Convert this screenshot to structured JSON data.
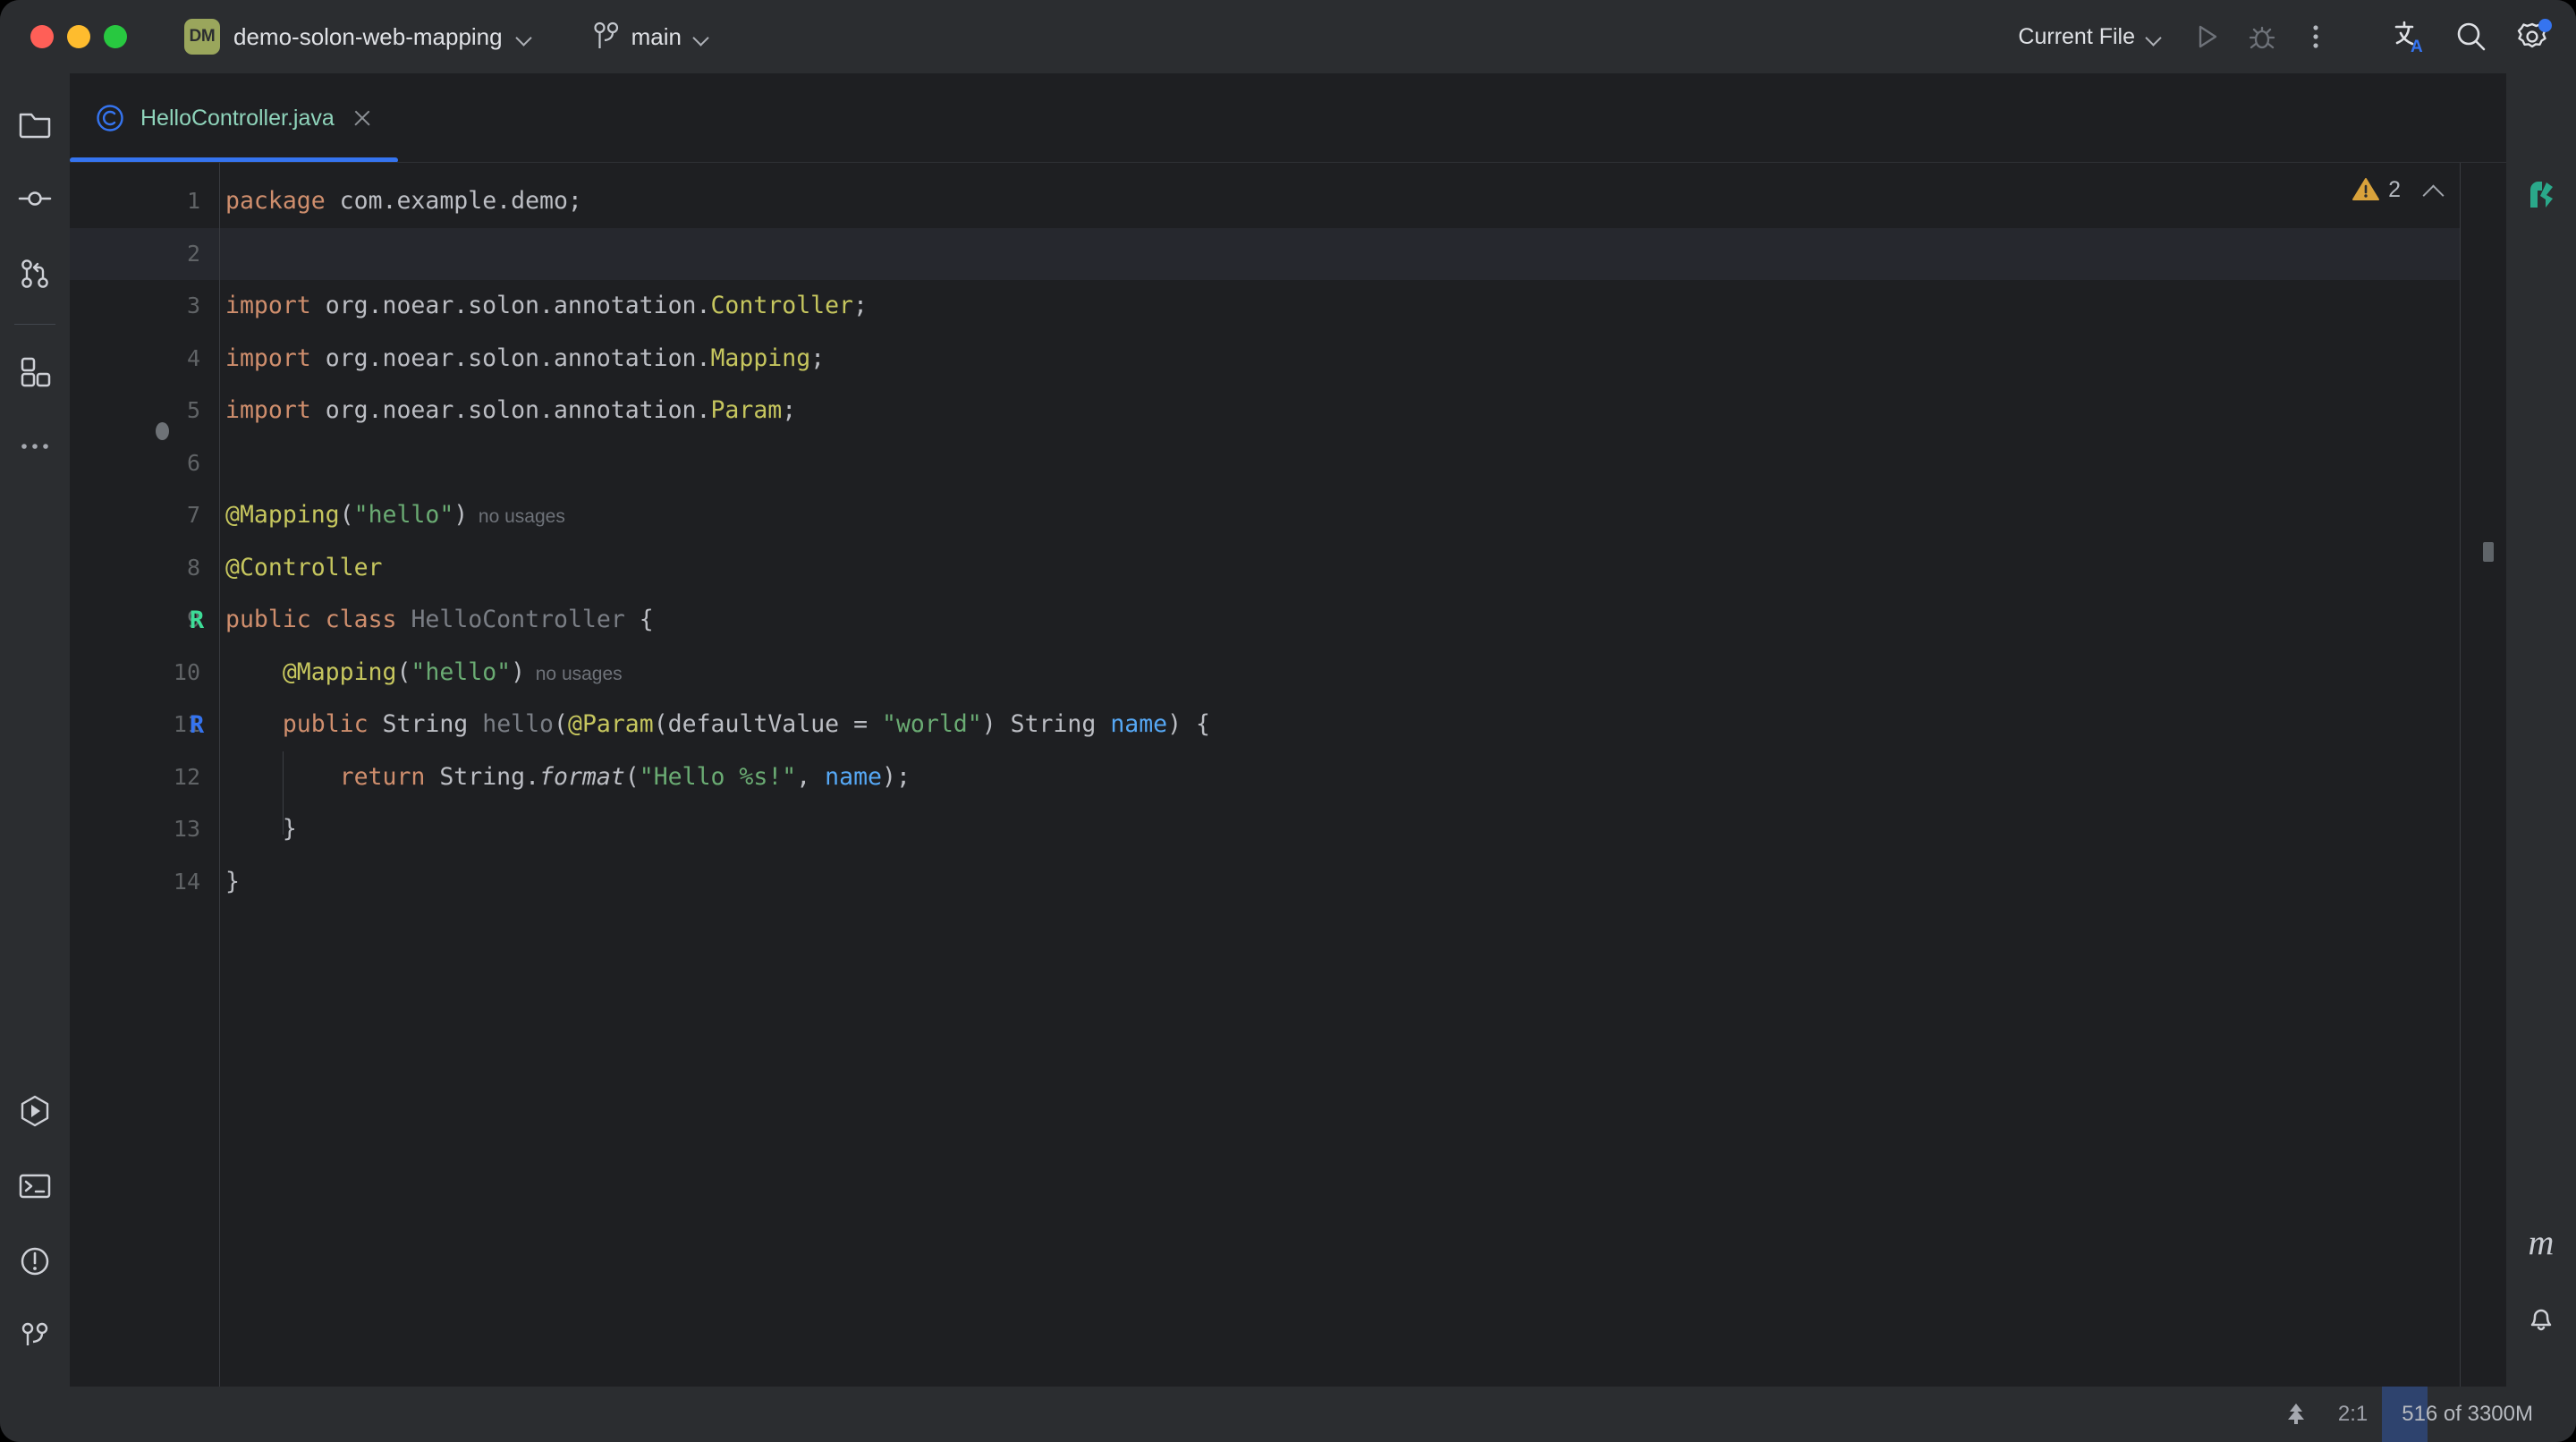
{
  "window": {
    "traffic_lights": [
      "close",
      "minimize",
      "maximize"
    ],
    "bg": "#2b2d30"
  },
  "titlebar": {
    "project_badge": "DM",
    "project_name": "demo-solon-web-mapping",
    "branch_name": "main",
    "run_config": "Current File",
    "icons": [
      "run-icon",
      "debug-icon",
      "more-options-icon",
      "translate-icon",
      "search-everywhere-icon",
      "settings-icon"
    ]
  },
  "sidebar_left": {
    "items": [
      {
        "name": "project-tool-window",
        "icon": "folder-icon"
      },
      {
        "name": "commit-tool-window",
        "icon": "commit-icon"
      },
      {
        "name": "pull-requests-tool-window",
        "icon": "pull-request-icon"
      },
      {
        "name": "plugins-tool-window",
        "icon": "grid-blocks-icon"
      },
      {
        "name": "more-tool-windows",
        "icon": "ellipsis-icon"
      }
    ],
    "bottom_items": [
      {
        "name": "run-tool-window",
        "icon": "run-hexagon-icon"
      },
      {
        "name": "terminal-tool-window",
        "icon": "terminal-icon"
      },
      {
        "name": "problems-tool-window",
        "icon": "problems-icon"
      },
      {
        "name": "version-control-tool-window",
        "icon": "branch-icon"
      }
    ]
  },
  "sidebar_right": {
    "top_items": [
      {
        "name": "solon-plugin-tool-window",
        "icon": "solon-leaf-icon"
      }
    ],
    "bottom_items": [
      {
        "name": "maven-tool-window",
        "icon": "maven-m-icon",
        "label": "m"
      },
      {
        "name": "notifications-tool-window",
        "icon": "bell-icon"
      }
    ]
  },
  "tabs": [
    {
      "label": "HelloController.java",
      "icon": "java-class-icon",
      "active": true,
      "closable": true
    }
  ],
  "editor": {
    "inspection": {
      "warning_count": "2",
      "icon": "warning-triangle-icon"
    },
    "current_line": 2,
    "lines": [
      {
        "n": 1,
        "indent": 0,
        "tokens": [
          {
            "t": "package",
            "c": "kw"
          },
          {
            "t": " ",
            "c": "pln"
          },
          {
            "t": "com.example.demo;",
            "c": "pln"
          }
        ]
      },
      {
        "n": 2,
        "indent": 0,
        "tokens": []
      },
      {
        "n": 3,
        "indent": 0,
        "tokens": [
          {
            "t": "import",
            "c": "kw"
          },
          {
            "t": " org.noear.solon.annotation.",
            "c": "pln"
          },
          {
            "t": "Controller",
            "c": "cls"
          },
          {
            "t": ";",
            "c": "pln"
          }
        ]
      },
      {
        "n": 4,
        "indent": 0,
        "tokens": [
          {
            "t": "import",
            "c": "kw"
          },
          {
            "t": " org.noear.solon.annotation.",
            "c": "pln"
          },
          {
            "t": "Mapping",
            "c": "cls"
          },
          {
            "t": ";",
            "c": "pln"
          }
        ]
      },
      {
        "n": 5,
        "indent": 0,
        "tokens": [
          {
            "t": "import",
            "c": "kw"
          },
          {
            "t": " org.noear.solon.annotation.",
            "c": "pln"
          },
          {
            "t": "Param",
            "c": "cls"
          },
          {
            "t": ";",
            "c": "pln"
          }
        ]
      },
      {
        "n": 6,
        "indent": 0,
        "tokens": []
      },
      {
        "n": 7,
        "indent": 0,
        "tokens": [
          {
            "t": "@Mapping",
            "c": "ann"
          },
          {
            "t": "(",
            "c": "pln"
          },
          {
            "t": "\"hello\"",
            "c": "str"
          },
          {
            "t": ")",
            "c": "pln"
          },
          {
            "t": "  no usages",
            "c": "hint"
          }
        ]
      },
      {
        "n": 8,
        "indent": 0,
        "tokens": [
          {
            "t": "@Controller",
            "c": "ann"
          }
        ]
      },
      {
        "n": 9,
        "indent": 0,
        "gutter": "R",
        "gutter_color": "green",
        "tokens": [
          {
            "t": "public",
            "c": "kw"
          },
          {
            "t": " ",
            "c": "pln"
          },
          {
            "t": "class",
            "c": "kw"
          },
          {
            "t": " ",
            "c": "pln"
          },
          {
            "t": "HelloController",
            "c": "mth"
          },
          {
            "t": " {",
            "c": "pln"
          }
        ]
      },
      {
        "n": 10,
        "indent": 1,
        "tokens": [
          {
            "t": "    @Mapping",
            "c": "ann"
          },
          {
            "t": "(",
            "c": "pln"
          },
          {
            "t": "\"hello\"",
            "c": "str"
          },
          {
            "t": ")",
            "c": "pln"
          },
          {
            "t": "  no usages",
            "c": "hint"
          }
        ]
      },
      {
        "n": 11,
        "indent": 1,
        "gutter": "R",
        "gutter_color": "blue",
        "tokens": [
          {
            "t": "    ",
            "c": "pln"
          },
          {
            "t": "public",
            "c": "kw"
          },
          {
            "t": " ",
            "c": "pln"
          },
          {
            "t": "String",
            "c": "typ"
          },
          {
            "t": " ",
            "c": "pln"
          },
          {
            "t": "hello",
            "c": "mth"
          },
          {
            "t": "(",
            "c": "pln"
          },
          {
            "t": "@Param",
            "c": "ann"
          },
          {
            "t": "(defaultValue = ",
            "c": "pln"
          },
          {
            "t": "\"world\"",
            "c": "str"
          },
          {
            "t": ") ",
            "c": "pln"
          },
          {
            "t": "String",
            "c": "typ"
          },
          {
            "t": " ",
            "c": "pln"
          },
          {
            "t": "name",
            "c": "par"
          },
          {
            "t": ") {",
            "c": "pln"
          }
        ]
      },
      {
        "n": 12,
        "indent": 2,
        "tokens": [
          {
            "t": "        ",
            "c": "pln"
          },
          {
            "t": "return",
            "c": "kw"
          },
          {
            "t": " ",
            "c": "pln"
          },
          {
            "t": "String",
            "c": "typ"
          },
          {
            "t": ".",
            "c": "pln"
          },
          {
            "t": "format",
            "c": "mthi"
          },
          {
            "t": "(",
            "c": "pln"
          },
          {
            "t": "\"Hello %s!\"",
            "c": "str"
          },
          {
            "t": ", ",
            "c": "pln"
          },
          {
            "t": "name",
            "c": "par"
          },
          {
            "t": ");",
            "c": "pln"
          }
        ]
      },
      {
        "n": 13,
        "indent": 1,
        "tokens": [
          {
            "t": "    }",
            "c": "pln"
          }
        ]
      },
      {
        "n": 14,
        "indent": 0,
        "tokens": [
          {
            "t": "}",
            "c": "pln"
          }
        ]
      }
    ]
  },
  "statusbar": {
    "tree_icon": "tree-icon",
    "caret_position": "2:1",
    "memory": "516 of 3300M",
    "memory_percent": 16
  },
  "colors": {
    "accent_blue": "#3574f0",
    "tab_text": "#8fd4bb",
    "keyword": "#cf8e6d",
    "string": "#6aab73",
    "annotation": "#c6c65e",
    "param": "#56a8f5",
    "warning": "#d9a23b",
    "run_green": "#3ddc97",
    "editor_bg": "#1e1f22",
    "chrome_bg": "#2b2d30"
  }
}
